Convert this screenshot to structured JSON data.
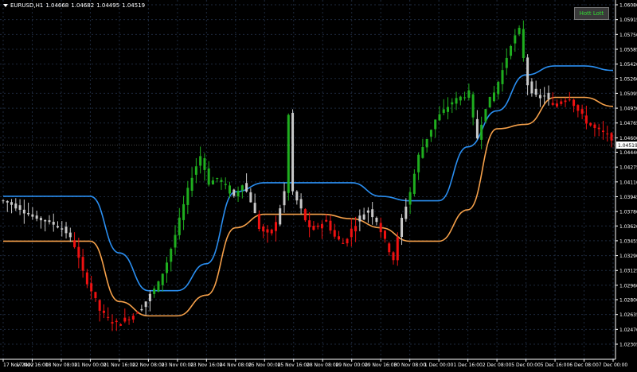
{
  "header": {
    "symbol": "EURUSD,H1",
    "open": "1.04668",
    "high": "1.04682",
    "low": "1.04495",
    "close": "1.04519"
  },
  "button": {
    "label": "Hott Lott",
    "label_color": "#33dd33"
  },
  "colors": {
    "background": "#000000",
    "grid": "#1e2a3e",
    "axis": "#ffffff",
    "bull": "#1fae1f",
    "bear": "#ee1111",
    "neutral": "#c8c8c8",
    "upper_band": "#2a8ef0",
    "lower_band": "#f5a04a",
    "price_tag_bg": "#ffffff"
  },
  "chart_data": {
    "type": "candlestick",
    "symbol": "EURUSD,H1",
    "grid": true,
    "price_axis": {
      "ticks": [
        "1.06080",
        "1.05915",
        "1.05750",
        "1.05585",
        "1.05420",
        "1.05260",
        "1.05095",
        "1.04930",
        "1.04765",
        "1.04600",
        "1.04440",
        "1.04275",
        "1.04110",
        "1.03945",
        "1.03780",
        "1.03620",
        "1.03455",
        "1.03290",
        "1.03125",
        "1.02960",
        "1.02800",
        "1.02635",
        "1.02470",
        "1.02305"
      ],
      "range": [
        1.0218,
        1.0614
      ],
      "current_price": "1.04519"
    },
    "time_axis": {
      "ticks": [
        "17 Nov 2022",
        "17 Nov 16:00",
        "18 Nov 08:00",
        "21 Nov 00:00",
        "21 Nov 16:00",
        "22 Nov 08:00",
        "23 Nov 00:00",
        "23 Nov 16:00",
        "24 Nov 08:00",
        "25 Nov 00:00",
        "25 Nov 16:00",
        "28 Nov 08:00",
        "29 Nov 00:00",
        "29 Nov 16:00",
        "30 Nov 08:00",
        "1 Dec 00:00",
        "1 Dec 16:00",
        "2 Dec 08:00",
        "5 Dec 00:00",
        "5 Dec 16:00",
        "6 Dec 08:00",
        "7 Dec 00:00"
      ]
    },
    "series": [
      {
        "role": "upper_band",
        "x": [
          "17 Nov 2022",
          "17 Nov 16:00",
          "18 Nov 08:00",
          "21 Nov 00:00",
          "21 Nov 16:00",
          "22 Nov 08:00",
          "23 Nov 00:00",
          "23 Nov 16:00",
          "24 Nov 08:00",
          "25 Nov 00:00",
          "25 Nov 16:00",
          "28 Nov 08:00",
          "29 Nov 00:00",
          "29 Nov 16:00",
          "30 Nov 08:00",
          "1 Dec 00:00",
          "1 Dec 16:00",
          "2 Dec 08:00",
          "5 Dec 00:00",
          "5 Dec 16:00",
          "6 Dec 08:00",
          "7 Dec 00:00"
        ],
        "y": [
          1.0395,
          1.0395,
          1.0395,
          1.0395,
          1.0332,
          1.029,
          1.029,
          1.032,
          1.04,
          1.041,
          1.041,
          1.041,
          1.041,
          1.0395,
          1.039,
          1.039,
          1.045,
          1.049,
          1.053,
          1.054,
          1.054,
          1.0535
        ]
      },
      {
        "role": "lower_band",
        "x": [
          "17 Nov 2022",
          "17 Nov 16:00",
          "18 Nov 08:00",
          "21 Nov 00:00",
          "21 Nov 16:00",
          "22 Nov 08:00",
          "23 Nov 00:00",
          "23 Nov 16:00",
          "24 Nov 08:00",
          "25 Nov 00:00",
          "25 Nov 16:00",
          "28 Nov 08:00",
          "29 Nov 00:00",
          "29 Nov 16:00",
          "30 Nov 08:00",
          "1 Dec 00:00",
          "1 Dec 16:00",
          "2 Dec 08:00",
          "5 Dec 00:00",
          "5 Dec 16:00",
          "6 Dec 08:00",
          "7 Dec 00:00"
        ],
        "y": [
          1.0345,
          1.0345,
          1.0345,
          1.0345,
          1.0278,
          1.0262,
          1.0262,
          1.0285,
          1.036,
          1.0375,
          1.0375,
          1.0375,
          1.037,
          1.036,
          1.0345,
          1.0345,
          1.038,
          1.047,
          1.0475,
          1.0505,
          1.0505,
          1.0495
        ]
      }
    ],
    "candles_note": "",
    "path_keypoints": [
      [
        0,
        1.039
      ],
      [
        4,
        1.0382
      ],
      [
        7,
        1.0372
      ],
      [
        10,
        1.0368
      ],
      [
        13,
        1.0362
      ],
      [
        15,
        1.0355
      ],
      [
        17,
        1.034
      ],
      [
        19,
        1.031
      ],
      [
        21,
        1.029
      ],
      [
        23,
        1.0268
      ],
      [
        25,
        1.0258
      ],
      [
        27,
        1.0253
      ],
      [
        29,
        1.0258
      ],
      [
        31,
        1.0263
      ],
      [
        33,
        1.0272
      ],
      [
        35,
        1.0285
      ],
      [
        37,
        1.0298
      ],
      [
        39,
        1.0322
      ],
      [
        41,
        1.0352
      ],
      [
        43,
        1.0385
      ],
      [
        45,
        1.0418
      ],
      [
        47,
        1.044
      ],
      [
        48,
        1.0425
      ],
      [
        49,
        1.041
      ],
      [
        51,
        1.0415
      ],
      [
        53,
        1.0405
      ],
      [
        55,
        1.0395
      ],
      [
        57,
        1.041
      ],
      [
        59,
        1.039
      ],
      [
        61,
        1.036
      ],
      [
        63,
        1.0352
      ],
      [
        65,
        1.0365
      ],
      [
        67,
        1.04
      ],
      [
        68,
        1.0485
      ],
      [
        69,
        1.04
      ],
      [
        71,
        1.038
      ],
      [
        73,
        1.0358
      ],
      [
        75,
        1.0362
      ],
      [
        77,
        1.0368
      ],
      [
        79,
        1.035
      ],
      [
        81,
        1.0342
      ],
      [
        83,
        1.0358
      ],
      [
        85,
        1.0372
      ],
      [
        87,
        1.038
      ],
      [
        89,
        1.0368
      ],
      [
        91,
        1.0345
      ],
      [
        93,
        1.0325
      ],
      [
        95,
        1.037
      ],
      [
        97,
        1.04
      ],
      [
        99,
        1.044
      ],
      [
        101,
        1.046
      ],
      [
        103,
        1.048
      ],
      [
        105,
        1.049
      ],
      [
        107,
        1.05
      ],
      [
        109,
        1.0505
      ],
      [
        111,
        1.051
      ],
      [
        112,
        1.048
      ],
      [
        113,
        1.046
      ],
      [
        115,
        1.0495
      ],
      [
        117,
        1.051
      ],
      [
        119,
        1.0535
      ],
      [
        121,
        1.0565
      ],
      [
        123,
        1.058
      ],
      [
        125,
        1.052
      ],
      [
        127,
        1.0505
      ],
      [
        129,
        1.0508
      ],
      [
        131,
        1.0495
      ],
      [
        133,
        1.0502
      ],
      [
        135,
        1.0505
      ],
      [
        137,
        1.049
      ],
      [
        139,
        1.0478
      ],
      [
        141,
        1.047
      ],
      [
        143,
        1.0465
      ],
      [
        145,
        1.046
      ]
    ]
  }
}
